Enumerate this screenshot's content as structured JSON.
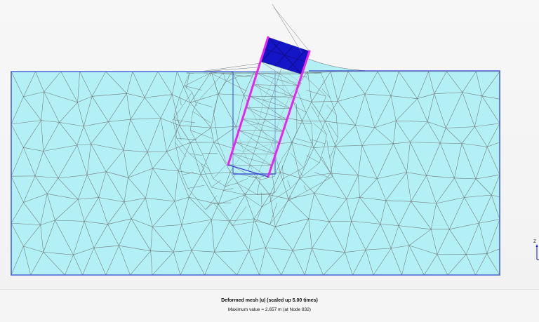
{
  "plot": {
    "title": "Deformed mesh |u| (scaled up 5.00 times)",
    "maximum_value": "Maximum value = 2.657 m (at Node 832)"
  },
  "axis_indicator": {
    "label": "Z"
  },
  "colors": {
    "soil_fill": "#b3f0f5",
    "soil_boundary": "#4a63d6",
    "mesh_lines": "#6f7878",
    "plate": "#ee22ee",
    "high_displacement": "#1515c8",
    "caption_bg": "#f5f5f5"
  }
}
